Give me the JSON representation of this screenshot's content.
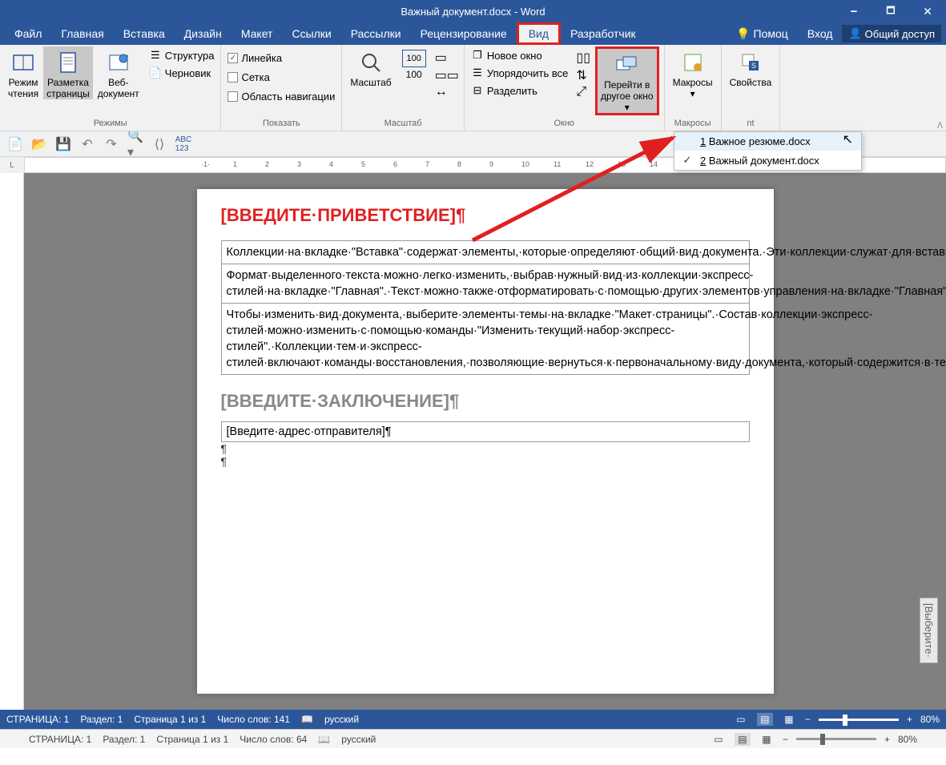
{
  "title": "Важный документ.docx - Word",
  "titlebar_buttons": {
    "min": "🗕",
    "max": "🗖",
    "close": "🗙"
  },
  "menu": {
    "file": "Файл",
    "home": "Главная",
    "insert": "Вставка",
    "design": "Дизайн",
    "layout": "Макет",
    "refs": "Ссылки",
    "mail": "Рассылки",
    "review": "Рецензирование",
    "view": "Вид",
    "developer": "Разработчик",
    "help": "Помоц",
    "signin": "Вход",
    "share": "Общий доступ"
  },
  "ribbon": {
    "modes": {
      "label": "Режимы",
      "read": "Режим\nчтения",
      "layout": "Разметка\nстраницы",
      "web": "Веб-\nдокумент",
      "structure": "Структура",
      "draft": "Черновик"
    },
    "show": {
      "label": "Показать",
      "ruler": "Линейка",
      "grid": "Сетка",
      "nav": "Область навигации"
    },
    "zoom": {
      "label": "Масштаб",
      "zoom_btn": "Масштаб",
      "hundred": "100"
    },
    "window": {
      "label": "Окно",
      "new": "Новое окно",
      "arrange": "Упорядочить все",
      "split": "Разделить",
      "switch": "Перейти в\nдругое окно"
    },
    "macros": {
      "label": "Макросы",
      "btn": "Макросы"
    },
    "sharepoint": {
      "label": "nt",
      "btn": "Свойства"
    }
  },
  "switch_dropdown": {
    "item1": {
      "num": "1",
      "label": "Важное резюме.docx"
    },
    "item2": {
      "num": "2",
      "label": "Важный документ.docx",
      "checked": "✓"
    }
  },
  "ruler_label": "L",
  "document": {
    "greeting": "[ВВЕДИТЕ·ПРИВЕТСТВИЕ]¶",
    "cell1": "Коллекции·на·вкладке·\"Вставка\"·содержат·элементы,·которые·определяют·общий·вид·документа.·Эти·коллекции·служат·для·вставки·в·документ·таблиц,·колонтитулов,·списков,·титульных·страниц·и·других·стандартных·блоков.·При·создании·рисунков,·диаграмм·или·схем·они·согласовываются·с·видом·текущего·документа.¶",
    "cell2": "Формат·выделенного·текста·можно·легко·изменить,·выбрав·нужный·вид·из·коллекции·экспресс-стилей·на·вкладке·\"Главная\".·Текст·можно·также·отформатировать·с·помощью·других·элементов·управления·на·вкладке·\"Главная\".·Большинство·элементов·управления·позволяют·использовать·вид·из·текущей·темы·и·формат,·указанный·непосредственно.¶",
    "cell3": "Чтобы·изменить·вид·документа,·выберите·элементы·темы·на·вкладке·\"Макет·страницы\".·Состав·коллекции·экспресс-стилей·можно·изменить·с·помощью·команды·\"Изменить·текущий·набор·экспресс-стилей\".·Коллекции·тем·и·экспресс-стилей·включают·команды·восстановления,·позволяющие·вернуться·к·первоначальному·виду·документа,·который·содержится·в·текущем·шаблоне.¶",
    "conclusion": "[ВВЕДИТЕ·ЗАКЛЮЧЕНИЕ]¶",
    "sender": "[Введите·адрес·отправителя]¶",
    "p1": "¶",
    "p2": "¶",
    "side_tab": "[Выберите·"
  },
  "status1": {
    "page": "СТРАНИЦА: 1",
    "section": "Раздел: 1",
    "pages": "Страница 1 из 1",
    "words": "Число слов: 141",
    "lang": "русский",
    "zoom": "80%",
    "minus": "−",
    "plus": "+"
  },
  "status2": {
    "page": "СТРАНИЦА: 1",
    "section": "Раздел: 1",
    "pages": "Страница 1 из 1",
    "words": "Число слов: 64",
    "lang": "русский",
    "zoom": "80%",
    "minus": "−",
    "plus": "+"
  }
}
